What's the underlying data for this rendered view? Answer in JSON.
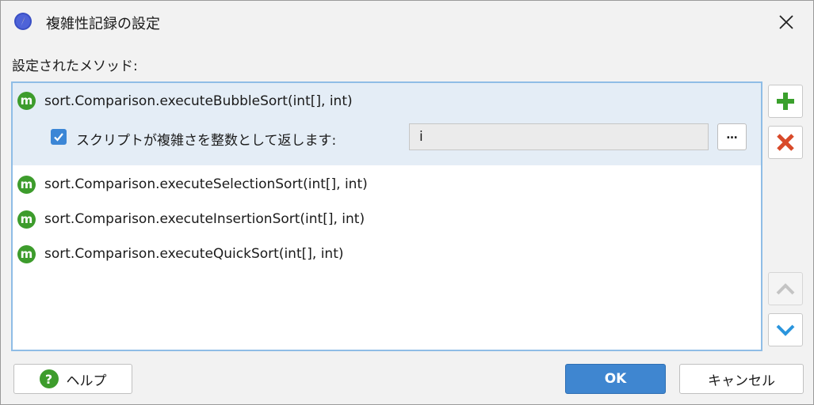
{
  "window": {
    "title": "複雑性記録の設定",
    "app_icon": "compass-icon",
    "close_icon": "close-icon"
  },
  "methods_label": "設定されたメソッド:",
  "methods": [
    {
      "icon_letter": "m",
      "name": "sort.Comparison.executeBubbleSort(int[], int)",
      "selected": true
    },
    {
      "icon_letter": "m",
      "name": "sort.Comparison.executeSelectionSort(int[], int)",
      "selected": false
    },
    {
      "icon_letter": "m",
      "name": "sort.Comparison.executeInsertionSort(int[], int)",
      "selected": false
    },
    {
      "icon_letter": "m",
      "name": "sort.Comparison.executeQuickSort(int[], int)",
      "selected": false
    }
  ],
  "script_option": {
    "checked": true,
    "label": "スクリプトが複雑さを整数として返します:",
    "value": "i",
    "browse_label": "…"
  },
  "side_buttons": {
    "add_icon": "plus-icon",
    "remove_icon": "x-icon",
    "up_icon": "chevron-up-icon",
    "down_icon": "chevron-down-icon"
  },
  "buttons": {
    "help_icon_text": "?",
    "help": "ヘルプ",
    "ok": "OK",
    "cancel": "キャンセル"
  },
  "colors": {
    "accent": "#3f86d0",
    "method_icon": "#3d9c2c",
    "add": "#3aa02c",
    "remove": "#d84a2a",
    "selection": "#e4edf6"
  }
}
